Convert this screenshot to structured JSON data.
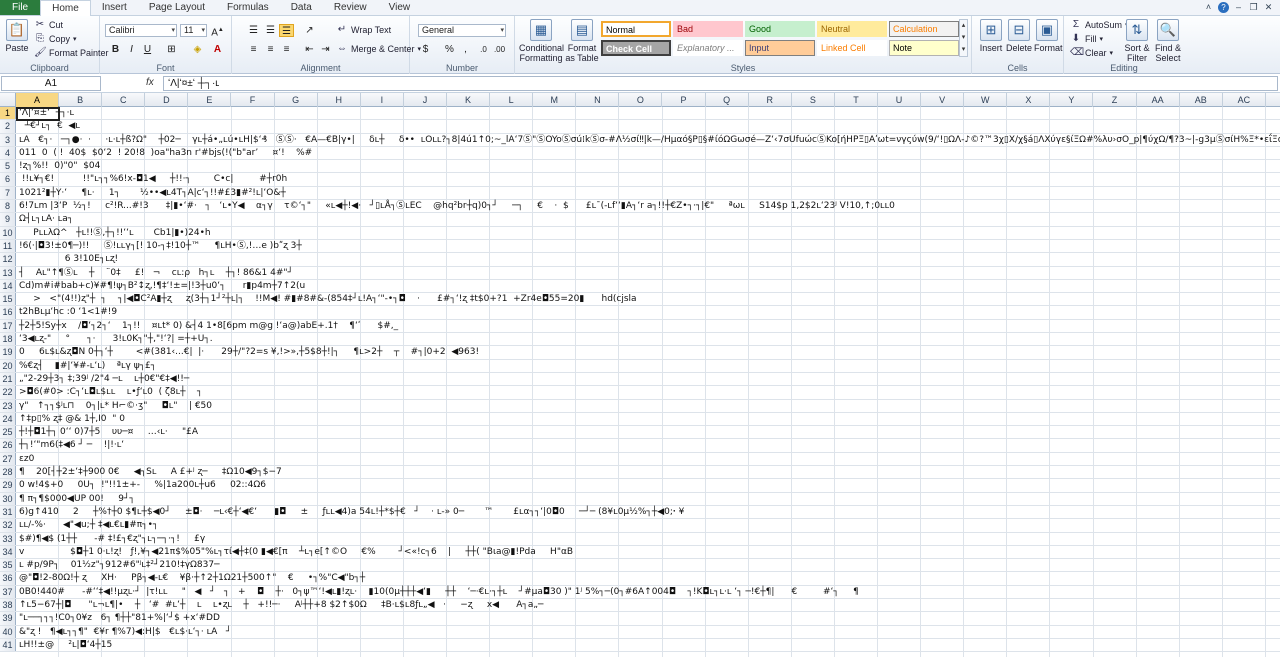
{
  "tabs": [
    {
      "label": "File",
      "kind": "file"
    },
    {
      "label": "Home",
      "kind": "active"
    },
    {
      "label": "Insert",
      "kind": ""
    },
    {
      "label": "Page Layout",
      "kind": ""
    },
    {
      "label": "Formulas",
      "kind": ""
    },
    {
      "label": "Data",
      "kind": ""
    },
    {
      "label": "Review",
      "kind": ""
    },
    {
      "label": "View",
      "kind": ""
    }
  ],
  "ribbon": {
    "clipboard": {
      "label": "Clipboard",
      "paste": "Paste",
      "cut": "Cut",
      "copy": "Copy",
      "format_painter": "Format Painter"
    },
    "font": {
      "label": "Font",
      "name": "Calibri",
      "size": "11",
      "bold": "B",
      "italic": "I",
      "underline": "U"
    },
    "alignment": {
      "label": "Alignment",
      "wrap": "Wrap Text",
      "merge": "Merge & Center"
    },
    "number": {
      "label": "Number",
      "format": "General",
      "currency": "$",
      "percent": "%",
      "comma": ","
    },
    "styles": {
      "label": "Styles",
      "conditional": "Conditional Formatting",
      "format_table": "Format as Table",
      "cells": [
        {
          "label": "Normal",
          "bg": "#ffffff",
          "fg": "#000000",
          "border": "#f2a72e"
        },
        {
          "label": "Bad",
          "bg": "#ffc7ce",
          "fg": "#9c0006",
          "border": "#ffc7ce"
        },
        {
          "label": "Good",
          "bg": "#c6efce",
          "fg": "#006100",
          "border": "#c6efce"
        },
        {
          "label": "Neutral",
          "bg": "#ffeb9c",
          "fg": "#9c6500",
          "border": "#ffeb9c"
        },
        {
          "label": "Calculation",
          "bg": "#f2f2f2",
          "fg": "#fa7d00",
          "border": "#7f7f7f"
        },
        {
          "label": "Check Cell",
          "bg": "#a5a5a5",
          "fg": "#ffffff",
          "border": "#3f3f3f"
        },
        {
          "label": "Explanatory ...",
          "bg": "#ffffff",
          "fg": "#7f7f7f",
          "border": "#ffffff"
        },
        {
          "label": "Input",
          "bg": "#ffcc99",
          "fg": "#3f3f76",
          "border": "#7f7f7f"
        },
        {
          "label": "Linked Cell",
          "bg": "#ffffff",
          "fg": "#fa7d00",
          "border": "#ffffff"
        },
        {
          "label": "Note",
          "bg": "#ffffcc",
          "fg": "#000000",
          "border": "#b2b2b2"
        }
      ]
    },
    "cells": {
      "label": "Cells",
      "insert": "Insert",
      "delete": "Delete",
      "format": "Format"
    },
    "editing": {
      "label": "Editing",
      "autosum": "AutoSum",
      "fill": "Fill",
      "clear": "Clear",
      "sort": "Sort & Filter",
      "find": "Find & Select"
    }
  },
  "formula_bar": {
    "name_box": "A1",
    "fx": "fx",
    "content": "ʻΛ|ʻ¤±ʻ  ┼┐·ʟ"
  },
  "columns": [
    "A",
    "B",
    "C",
    "D",
    "E",
    "F",
    "G",
    "H",
    "I",
    "J",
    "K",
    "L",
    "M",
    "N",
    "O",
    "P",
    "Q",
    "R",
    "S",
    "T",
    "U",
    "V",
    "W",
    "X",
    "Y",
    "Z",
    "AA",
    "AB",
    "AC"
  ],
  "rows": [
    {
      "n": "1",
      "text": "ʻΛ|ʻ¤±ʻ  ┼┐·ʟ"
    },
    {
      "n": "2",
      "text": "  ┴€┘ʟ┐  €  ◀ʟ"
    },
    {
      "n": "3",
      "text": "ʟA   €┐·   ─┐●·  ·     ·ʟ·ʟ┼ß?Ω\"    ┼02─    γʟ┼á•„ʟú•ʟH|$ʻ₰   ⓈⓈ·   €A—€B|γ•|     δʟ┼     δ••  ʟOʟʟ?┐8|4ú1↑0;~_lAʻ7Ⓢ\"ⓈOYoⓈσú⁞kⓈσ-#Λ½σί‼|k—/Hμαό§P▯§#ίόΩGωσé—Zʻ‹7σUfuώcⓈKo[ήHPΞ▯Αʹωt=νγςύw(9/ʻ!▯ΩΛ-♪©?™3χ▯X/χ§á▯ΛXύγε§ίΞΩ#%λυ›σO_p|¶ύχΩ/¶?3~|-g3μⓈσίΗ%Ξ*•εΐΞσκⓈ7υ5Ωz?(Ωό"
    },
    {
      "n": "4",
      "text": "011  0  ( !  40$  $0ʻ2  ! 20!8  )oa\"ha3n r'#bjs(!(\"b\"arʼ     ¤ʻ!    %#"
    },
    {
      "n": "5",
      "text": "!ʐ┐%!!  0)\"0\"  $04"
    },
    {
      "n": "6",
      "text": " !!ʟ¥┐€!          !!\"ʟ┐┐%6!x-◘1◀     ┼!!·┐        C•c|         #┼r0h"
    },
    {
      "n": "7",
      "text": "1021²▮┼Y·ʻ     ¶ʟ·     1┐       ½••◀ʟ4T┐A|cʻ┐!!#£3▮#²!ʟ|ʻO&┼"
    },
    {
      "n": "8",
      "text": "6!7ʟm |3ʻP  ½┐!     c²!R...#!3      ‡|▮•ʻ#·   ┐   ʻʟ•Y◀    α┐γ    τ©ʻ┐\"     «ʟ◀┼!◀·   ┘▯ʟÅ┐ⓈʟEC    @hq²br┼q)0┐┘     ─┐     €    ·  $      £ʟ¯(-ʟfʻʻ▮A┐ʻr a┐!!┼€Z•┐·┐|€\"     ªωʟ     S14$p 1,2$2ʟʻ23ʲ V!10,↑;0ʟʟ0"
    },
    {
      "n": "9",
      "text": "Ω┤ʟ┐ʟA· ʟa┐"
    },
    {
      "n": "10",
      "text": "     PʟʟλΩ^   ┼ʟ!!Ⓢ,┼┐!!ʻʻʟ       Cb1|▮•)24•h"
    },
    {
      "n": "11",
      "text": "!6(·|◘3!±0¶─)!!     Ⓢ!ʟʟγ┐[! 10-┐‡!10┼™     ¶ʟH•Ⓢ,!…e )bʺʐ 3┼"
    },
    {
      "n": "12",
      "text": "                6 3!10E┐ʟʐ!"
    },
    {
      "n": "13",
      "text": "┤    Aʟ\"↑¶Ⓢʟ    ┼    ¨0‡     £!   ¬    cʟ:ρ   h┐ʟ    ┼┐! 86&1 4#\"┘"
    },
    {
      "n": "14",
      "text": "Cd)m#i#bab+c)¥#¶!ψ┐B²↕ʐ,!¶‡ʻ!±=|!3┼u0ʻ┐      r▮p4m┼7↑2(u"
    },
    {
      "n": "15",
      "text": "     >   <\"(4!!)ʐ\"┼  ┐    ┐|◀◘C²A▮┼ʐ     ʐ(3┼┐1┘²┼ʟ|┐    !!M◀! #▮#8#&-(854‡┘ʟ!A┐ʻ\"-•┐◘    ·      £#┐ʻ!ʐ ‡t$0+?1  +Zr4e◘55=20▮      hd(cjsla"
    },
    {
      "n": "16",
      "text": "t2hBʟμʻhc :0 ʻ1<1#!9"
    },
    {
      "n": "17",
      "text": "┼2┼5!Sy┼x    /◘ʻ┐2┐ʻ    1┐!!    ¤ʟt* 0) &┤4 1•8[6pm m@g !ʻa@)abE+.1†    ¶ʻʹ      $#,_"
    },
    {
      "n": "18",
      "text": "ʻ3◀ʟʐ-\"     °      ┐·      3!ʟ0K┐\"┼,\"!ʻ?| =┼+U┐."
    },
    {
      "n": "19",
      "text": "0     6ʟ$ʟ&ʐ◘N 0┼┐ʻ┼        <#(381‹...€|  |·      29┼/\"?2=s ¥,!>»,┼5$8┼!|┐     ¶ʟ>2┼    ┬    #┐|0+2  ◀963!"
    },
    {
      "n": "20",
      "text": "%€ʐ┤    ▮#|ʻ¥#-ʟʻʟ)    ªʟγ ψ┐£┐"
    },
    {
      "n": "21",
      "text": "„\"2-29┼3┐ ‡;39ʲ /2\"4 ─ʟ    ʟ┼0€\"€‡◀!!─"
    },
    {
      "n": "22",
      "text": ">◘6(#0> :C┐ʻʟ◘ʟ$ʟʟ    ʟ•ƒʻʟ0  ( ζ8ʟ┼    ┐"
    },
    {
      "n": "23",
      "text": "γ\"   ↑┐┐$ʲʟ⊓    0┐|ʟ* H⌐©·ʒ\"     ◘ʟ\"    | €50"
    },
    {
      "n": "24",
      "text": "↑‡p▯% ʐ‡ @& 1┼,I0  \" 0"
    },
    {
      "n": "25",
      "text": "┼!┼◘1┼┐ 0ʻʻ 0)7┼5    υυ─¤     …‹ʟ·     \"£A"
    },
    {
      "n": "26",
      "text": "┼┐!ʻ\"m6(‡◀6 ┘ ─    !|!·ʟʻ"
    },
    {
      "n": "27",
      "text": "εz0"
    },
    {
      "n": "28",
      "text": "¶    20[┤┼2±ʻ‡┼900 0€     ◀┐Sʟ     A £+ʲ ʐ─     ‡Ω10◀9┐$−7"
    },
    {
      "n": "29",
      "text": "0 w!4$+0     0U┐  !\"!!1±+-     %|1a200ʟ┼u6     02::4Ω6"
    },
    {
      "n": "30",
      "text": "¶ π┐¶$000◀UP 00!     9┘┐"
    },
    {
      "n": "31",
      "text": "6)g↑410     2     ┼%†┼0 $¶ʟ┼$◀0┘     ±◘·    ─ʟ‹€┼ʻ◀€ʻ      ▮◘     ±     ƒʟʟ◀4)a 54ʟ!┼*$┼€   ┘    · ʟ-» 0─       ™       £ʟα┐┐ʻ|0◘0     ─┘─ (8¥ʟ0μ½%┐┼◀0;ꞏ ¥"
    },
    {
      "n": "32",
      "text": "ʟʟ/-%·      ◀\"◀u;┼ ‡◀ʟ€ʟ▮#π┐•┐"
    },
    {
      "n": "33",
      "text": "$#)¶◀$ (1┼┼      -# ‡!£┐€ʐ\"┐ʟ┐─┐·┐!     £γ"
    },
    {
      "n": "34",
      "text": "v                $◘┼1 0·ʟ!ʐ!   ƒ!,¥┐◀21π$%05\"%ʟ┐τί◀┼‡(0 ▮◀€[π    ┴ʟ┐e[↑©O     €%        ┘<«!c┐6    |     ┼┼( \"Bιa@▮!Pda     H\"αB"
    },
    {
      "n": "35",
      "text": "ʟ #p/9P┐    01½z\"┐912#6\"ʲʟ‡²┘210!‡γΩ837─"
    },
    {
      "n": "36",
      "text": "@\"◘!2-80Ω!┼ ʐ     XH·     Pβ┐◀-ʟ€    ¥β·┼↑2┼1Ω21┼500↑\"    €     •┐%\"C◀\"b┐┼"
    },
    {
      "n": "37",
      "text": "0B0!440#      -#ʻʻ‡◀!!μʐʟ·┘  |τ!ʟʟ     \"   ◀   ┘   ┐   +    ◘    ┼·   0┐ψ™ʻ!◀ʟ▮!ʐʟ·    ▮10(0μ┼┼┼◀ʻ▮     ┼┼    ʻ─·€ʟ·┐┼ʟ    ┘#μa◘30 )\" 1ʲ 5%┐─(0┐#6A↑004◘    ┐!K◘ʟ┐ʟ·ʟ ʻ┐ ─!€┼¶|      €         #ʻ┐     ¶"
    },
    {
      "n": "38",
      "text": "↑ʟ5−67┼|◘      \"ʟ¬ʟ¶|•    ┼   ʻ#  #ʟʻ┼    ʟ    ʟ•ʐʟ    ┼   +!!─·     Aʲ┼┼+8 $2↑$0Ω     ‡B·ʟ$ʟ8ƒʟ„◀   ·     −ʐ     x◀      A┐a„─"
    },
    {
      "n": "39",
      "text": "\"ʟ──┐┐┐!C0┐0¥z   6┐ ¶┼┼\"81+%|ʻ┘$ +xʻ#DD"
    },
    {
      "n": "40",
      "text": "&\"ʐ !   ¶◀ʟ┐┐¶\"  €¥r ¶%7)◀:H|$   €ʟ$·ʟʻ┐· ʟA   ┘"
    },
    {
      "n": "41",
      "text": "ʟH!!±@     ²ʟ|◘ʻ4┼15"
    }
  ]
}
